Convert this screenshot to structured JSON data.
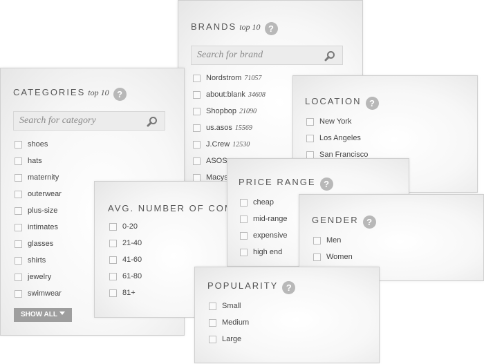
{
  "brands": {
    "title": "BRANDS",
    "top10": "top 10",
    "help": "?",
    "search_placeholder": "Search for brand",
    "items": [
      {
        "label": "Nordstrom",
        "count": "71057"
      },
      {
        "label": "about:blank",
        "count": "34608"
      },
      {
        "label": "Shopbop",
        "count": "21090"
      },
      {
        "label": "us.asos",
        "count": "15569"
      },
      {
        "label": "J.Crew",
        "count": "12530"
      },
      {
        "label": "ASOS",
        "count": ""
      },
      {
        "label": "Macys",
        "count": ""
      }
    ]
  },
  "categories": {
    "title": "CATEGORIES",
    "top10": "top 10",
    "help": "?",
    "search_placeholder": "Search for category",
    "items": [
      "shoes",
      "hats",
      "maternity",
      "outerwear",
      "plus-size",
      "intimates",
      "glasses",
      "shirts",
      "jewelry",
      "swimwear"
    ],
    "show_all": "SHOW ALL"
  },
  "location": {
    "title": "LOCATION",
    "help": "?",
    "items": [
      "New York",
      "Los Angeles",
      "San Francisco"
    ]
  },
  "avg_comments": {
    "title": "AVG. NUMBER OF COMM",
    "items": [
      "0-20",
      "21-40",
      "41-60",
      "61-80",
      "81+"
    ]
  },
  "price_range": {
    "title": "PRICE RANGE",
    "help": "?",
    "items": [
      "cheap",
      "mid-range",
      "expensive",
      "high end"
    ]
  },
  "gender": {
    "title": "GENDER",
    "help": "?",
    "items": [
      "Men",
      "Women"
    ]
  },
  "popularity": {
    "title": "POPULARITY",
    "help": "?",
    "items": [
      "Small",
      "Medium",
      "Large"
    ]
  },
  "colors": {
    "panel_border": "#cfcfcf",
    "help_badge": "#b8b8b8",
    "show_all_bg": "#9e9e9e",
    "text": "#444444"
  },
  "icons": {
    "search": "magnifier-icon",
    "help": "question-circle-icon",
    "dropdown": "triangle-down-icon"
  }
}
